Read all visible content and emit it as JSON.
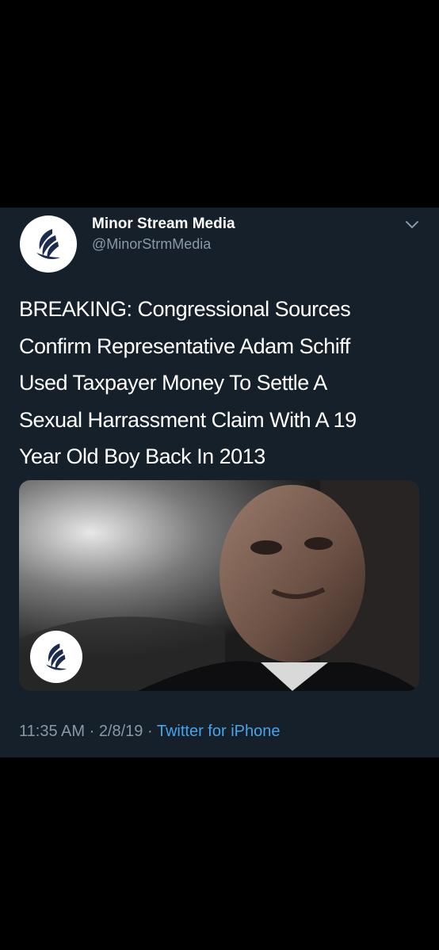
{
  "tweet": {
    "display_name": "Minor Stream Media",
    "handle": "@MinorStrmMedia",
    "text_lines": [
      "BREAKING: Congressional Sources",
      "Confirm Representative Adam Schiff",
      "Used Taxpayer Money To Settle A",
      "Sexual Harrassment Claim With A 19",
      "Year Old Boy Back In 2013"
    ],
    "time": "11:35 AM",
    "separator": " · ",
    "date": "2/8/19",
    "source": "Twitter for iPhone"
  },
  "icons": {
    "avatar": "bird-logo-icon",
    "menu": "chevron-down-icon",
    "media_logo": "bird-logo-icon"
  },
  "colors": {
    "background": "#000000",
    "card": "#15202b",
    "text": "#ffffff",
    "muted": "#8899a6",
    "link": "#4aa3e8",
    "logo": "#1d2b4f"
  }
}
